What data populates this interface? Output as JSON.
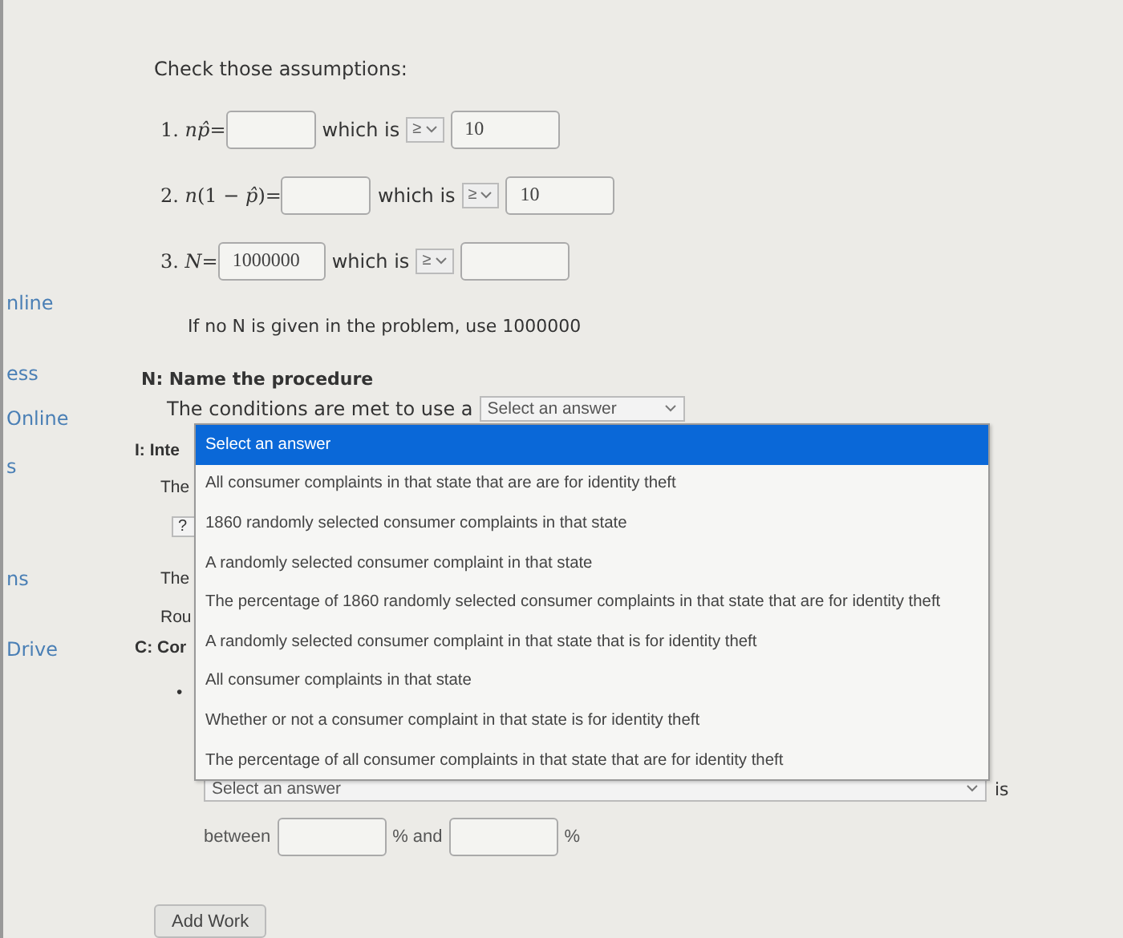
{
  "sidebar": {
    "items": [
      "nline",
      "ess",
      "Online",
      "s",
      "ns",
      "Drive"
    ]
  },
  "assumptions": {
    "title": "Check those assumptions:",
    "rows": [
      {
        "label": "1. *np̂*=",
        "value": "",
        "relation": "which is",
        "operator": "≥",
        "compare": "10"
      },
      {
        "label": "2. *n*(1 − *p̂*)=",
        "value": "",
        "relation": "which is",
        "operator": "≥",
        "compare": "10"
      },
      {
        "label": "3. *N*=",
        "value": "1000000",
        "relation": "which is",
        "operator": "≥",
        "compare": ""
      }
    ],
    "note": "If no N is given in the problem, use 1000000"
  },
  "procedure": {
    "heading": "N: Name the procedure",
    "sentence": "The conditions are met to use a",
    "select": "Select an answer"
  },
  "covered": [
    {
      "kind": "heading",
      "text": "I: Inte"
    },
    {
      "kind": "text",
      "text": "The"
    },
    {
      "kind": "select",
      "text": "?"
    },
    {
      "kind": "text",
      "text": "The"
    },
    {
      "kind": "text",
      "text": "Rou"
    },
    {
      "kind": "heading",
      "text": "C: Cor"
    },
    {
      "kind": "bullet",
      "text": "•"
    }
  ],
  "dropdown": {
    "options": [
      {
        "text": "Select an answer",
        "selected": true
      },
      {
        "text": "All consumer complaints in that state that are are for identity theft",
        "selected": false
      },
      {
        "text": "1860 randomly selected consumer complaints in that state",
        "selected": false
      },
      {
        "text": "A randomly selected consumer complaint in that state",
        "selected": false
      },
      {
        "text": "The percentage of 1860 randomly selected consumer complaints in that state that are for identity theft",
        "selected": false
      },
      {
        "text": "A randomly selected consumer complaint in that state that is for identity theft",
        "selected": false
      },
      {
        "text": "All consumer complaints in that state",
        "selected": false
      },
      {
        "text": "Whether or not a consumer complaint in that state is for identity theft",
        "selected": false
      },
      {
        "text": "The percentage of all consumer complaints in that state that are for identity theft",
        "selected": false
      }
    ]
  },
  "conclusion": {
    "select": "Select an answer",
    "after": "is",
    "between": "between",
    "mid": "% and",
    "end": "%"
  },
  "add_work": "Add Work"
}
